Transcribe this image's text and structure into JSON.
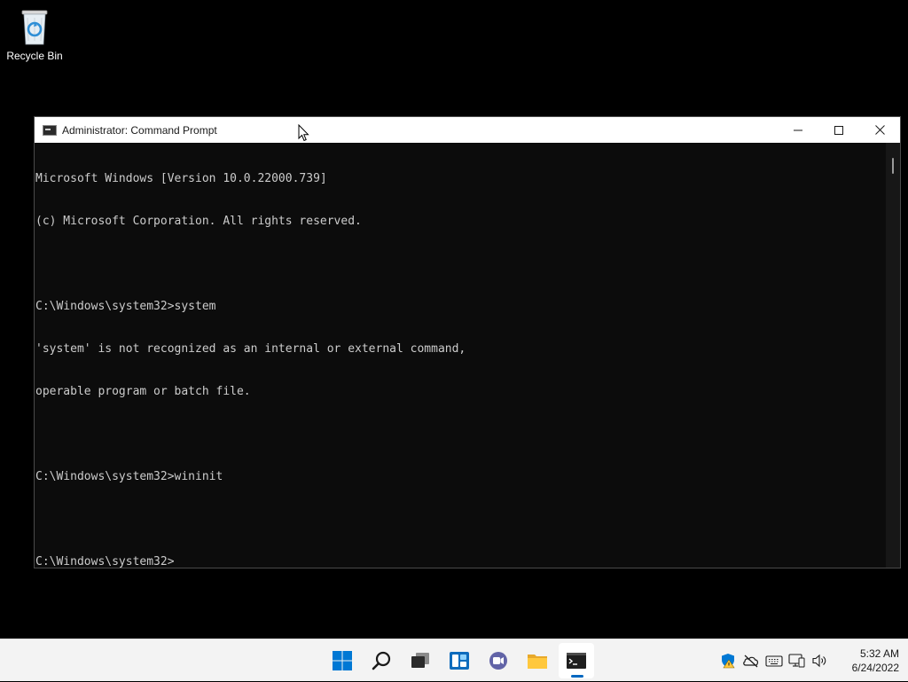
{
  "desktop": {
    "icons": [
      {
        "label": "Recycle Bin",
        "icon": "recycle-bin-icon"
      }
    ]
  },
  "window": {
    "title": "Administrator: Command Prompt",
    "icon": "command-prompt-icon",
    "controls": [
      "minimize-icon",
      "maximize-icon",
      "close-icon"
    ]
  },
  "console": {
    "lines": [
      "Microsoft Windows [Version 10.0.22000.739]",
      "(c) Microsoft Corporation. All rights reserved.",
      "",
      "C:\\Windows\\system32>system",
      "'system' is not recognized as an internal or external command,",
      "operable program or batch file.",
      "",
      "C:\\Windows\\system32>wininit",
      "",
      "C:\\Windows\\system32>"
    ],
    "background": "#0c0c0c",
    "foreground": "#cccccc"
  },
  "taskbar": {
    "background": "#f3f3f3",
    "accent": "#0067c0",
    "pinned": [
      {
        "name": "start-button",
        "icon": "windows-logo-icon"
      },
      {
        "name": "search-button",
        "icon": "search-icon"
      },
      {
        "name": "task-view-button",
        "icon": "task-view-icon"
      },
      {
        "name": "widgets-button",
        "icon": "widgets-icon"
      },
      {
        "name": "chat-button",
        "icon": "chat-icon"
      },
      {
        "name": "file-explorer-button",
        "icon": "folder-icon"
      },
      {
        "name": "command-prompt-taskbar-button",
        "icon": "command-prompt-icon",
        "active": true
      }
    ],
    "tray": [
      "security-shield-icon",
      "onedrive-icon",
      "keyboard-icon",
      "network-icon",
      "volume-icon"
    ],
    "clock": {
      "time": "5:32 AM",
      "date": "6/24/2022"
    }
  }
}
